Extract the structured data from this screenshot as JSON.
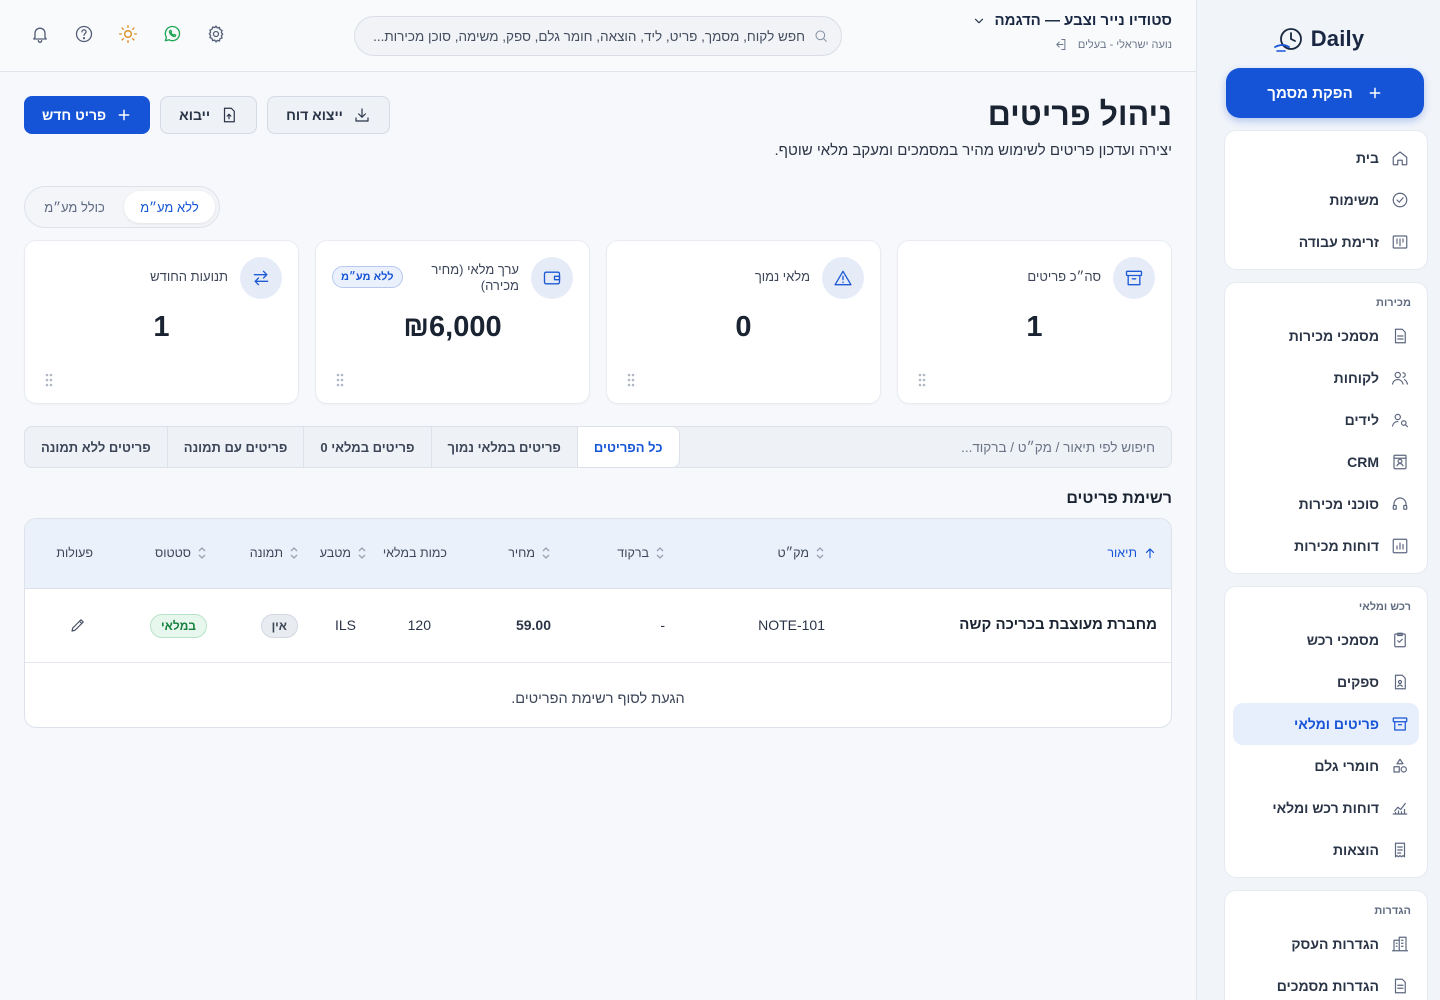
{
  "sidebar": {
    "logo_text": "Daily",
    "cta_label": "הפקת מסמך",
    "groups": [
      {
        "title": "",
        "items": [
          {
            "label": "בית",
            "icon": "home-icon"
          },
          {
            "label": "משימות",
            "icon": "check-circle-icon"
          },
          {
            "label": "זרימת עבודה",
            "icon": "kanban-icon"
          }
        ]
      },
      {
        "title": "מכירות",
        "items": [
          {
            "label": "מסמכי מכירות",
            "icon": "document-icon"
          },
          {
            "label": "לקוחות",
            "icon": "users-icon"
          },
          {
            "label": "לידים",
            "icon": "user-search-icon"
          },
          {
            "label": "CRM",
            "icon": "contact-card-icon"
          },
          {
            "label": "סוכני מכירות",
            "icon": "headset-icon"
          },
          {
            "label": "דוחות מכירות",
            "icon": "bar-chart-icon"
          }
        ]
      },
      {
        "title": "רכש ומלאי",
        "items": [
          {
            "label": "מסמכי רכש",
            "icon": "clipboard-check-icon"
          },
          {
            "label": "ספקים",
            "icon": "supplier-file-icon"
          },
          {
            "label": "פריטים ומלאי",
            "icon": "archive-box-icon",
            "active": true
          },
          {
            "label": "חומרי גלם",
            "icon": "shapes-icon"
          },
          {
            "label": "דוחות רכש ומלאי",
            "icon": "line-chart-icon"
          },
          {
            "label": "הוצאות",
            "icon": "receipt-icon"
          }
        ]
      },
      {
        "title": "הגדרות",
        "items": [
          {
            "label": "הגדרות העסק",
            "icon": "building-icon"
          },
          {
            "label": "הגדרות מסמכים",
            "icon": "file-settings-icon"
          }
        ]
      }
    ]
  },
  "header": {
    "business_name": "סטודיו נייר וצבע — הדגמה",
    "user_line": "נועה ישראלי - בעלים",
    "search_placeholder": "חפש לקוח, מסמך, פריט, ליד, הוצאה, חומר גלם, ספק, משימה, סוכן מכירות..."
  },
  "page": {
    "title": "ניהול פריטים",
    "subtitle": "יצירה ועדכון פריטים לשימוש מהיר במסמכים ומעקב מלאי שוטף.",
    "actions": {
      "new_item": "פריט חדש",
      "import": "ייבוא",
      "export": "ייצוא דוח"
    },
    "vat_toggle": {
      "without": "ללא מע״מ",
      "with": "כולל מע״מ"
    }
  },
  "stats": [
    {
      "label": "סה״כ פריטים",
      "value": "1",
      "icon": "archive-box-icon"
    },
    {
      "label": "מלאי נמוך",
      "value": "0",
      "icon": "warning-triangle-icon"
    },
    {
      "label": "ערך מלאי (מחיר מכירה)",
      "value": "₪6,000",
      "icon": "wallet-icon",
      "badge": "ללא מע״מ"
    },
    {
      "label": "תנועות החודש",
      "value": "1",
      "icon": "swap-arrows-icon"
    }
  ],
  "list": {
    "search_placeholder": "חיפוש לפי תיאור / מק״ט / ברקוד...",
    "filters": [
      "כל הפריטים",
      "פריטים במלאי נמוך",
      "פריטים במלאי 0",
      "פריטים עם תמונה",
      "פריטים ללא תמונה"
    ],
    "section_title": "רשימת פריטים",
    "columns": {
      "description": "תיאור",
      "sku": "מק״ט",
      "barcode": "ברקוד",
      "price": "מחיר",
      "stock": "כמות במלאי",
      "currency": "מטבע",
      "image": "תמונה",
      "status": "סטטוס",
      "actions": "פעולות"
    },
    "rows": [
      {
        "description": "מחברת מעוצבת בכריכה קשה",
        "sku": "NOTE-101",
        "barcode": "-",
        "price": "59.00",
        "stock": "120",
        "currency": "ILS",
        "image": "אין",
        "status": "במלאי"
      }
    ],
    "end_note": "הגעת לסוף רשימת הפריטים."
  },
  "colors": {
    "accent": "#1554d6",
    "success": "#15803d",
    "background": "#f6f8fb"
  }
}
